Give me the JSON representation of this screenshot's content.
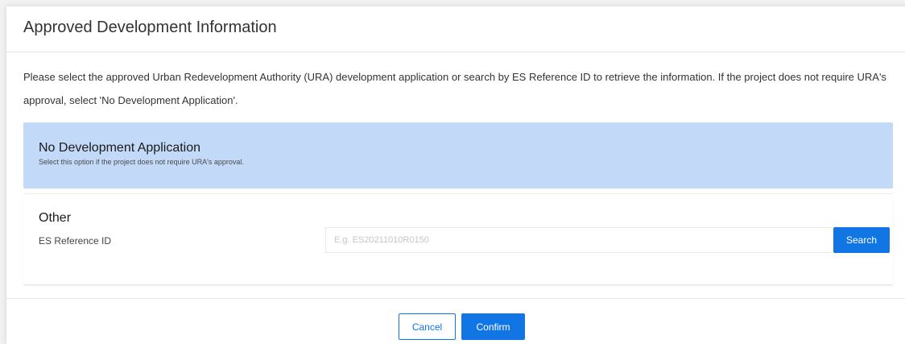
{
  "modal": {
    "title": "Approved Development Information",
    "description": "Please select the approved Urban Redevelopment Authority (URA) development application or search by ES Reference ID to retrieve the information. If the project does not require URA's approval, select 'No Development Application'."
  },
  "options": {
    "no_development": {
      "title": "No Development Application",
      "subtitle": "Select this option if the project does not require URA's approval.",
      "selected": true
    },
    "other": {
      "title": "Other",
      "field_label": "ES Reference ID",
      "input_value": "",
      "input_placeholder": "E.g. ES20211010R0150",
      "search_label": "Search"
    }
  },
  "footer": {
    "cancel_label": "Cancel",
    "confirm_label": "Confirm"
  },
  "colors": {
    "accent": "#1176e3",
    "selected_option_bg": "#c3d9f8"
  }
}
